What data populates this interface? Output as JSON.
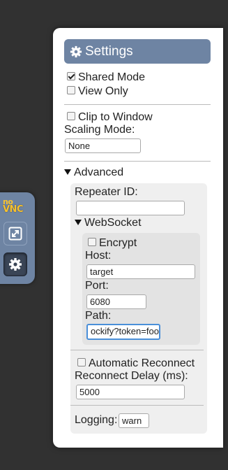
{
  "control_bar": {
    "logo_top": "no",
    "logo_bottom": "VNC"
  },
  "settings": {
    "title": "Settings",
    "shared_mode": {
      "label": "Shared Mode",
      "checked": true
    },
    "view_only": {
      "label": "View Only",
      "checked": false
    },
    "clip_to_window": {
      "label": "Clip to Window",
      "checked": false
    },
    "scaling_mode": {
      "label": "Scaling Mode:",
      "value": "None"
    },
    "advanced": {
      "label": "Advanced",
      "repeater_id": {
        "label": "Repeater ID:",
        "value": ""
      },
      "websocket": {
        "label": "WebSocket",
        "encrypt": {
          "label": "Encrypt",
          "checked": false
        },
        "host": {
          "label": "Host:",
          "value": "target"
        },
        "port": {
          "label": "Port:",
          "value": "6080"
        },
        "path": {
          "label": "Path:",
          "value": "ockify?token=foo"
        }
      },
      "auto_reconnect": {
        "label": "Automatic Reconnect",
        "checked": false
      },
      "reconnect_delay": {
        "label": "Reconnect Delay (ms):",
        "value": "5000"
      },
      "logging": {
        "label": "Logging:",
        "value": "warn"
      }
    }
  },
  "colors": {
    "background": "#313131",
    "accent": "#6e84a3",
    "logo": "#f8c22e",
    "focus": "#4a8fd9"
  }
}
